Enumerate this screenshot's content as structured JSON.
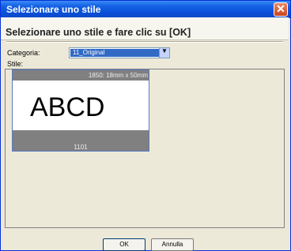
{
  "window": {
    "title": "Selezionare uno stile"
  },
  "dialog": {
    "instruction": "Selezionare uno stile e fare clic su [OK]",
    "category_label": "Categoria:",
    "category_value": "11_Original",
    "style_label": "Stile:"
  },
  "styles": [
    {
      "dimensions": "1850: 18mm x 50mm",
      "preview_text": "ABCD",
      "code": "1101"
    }
  ],
  "buttons": {
    "ok": "OK",
    "cancel": "Annulla"
  },
  "icons": {
    "close": "close-icon",
    "dropdown": "chevron-down-icon"
  },
  "colors": {
    "titlebar": "#0a4fd8",
    "selection": "#316ac5"
  }
}
